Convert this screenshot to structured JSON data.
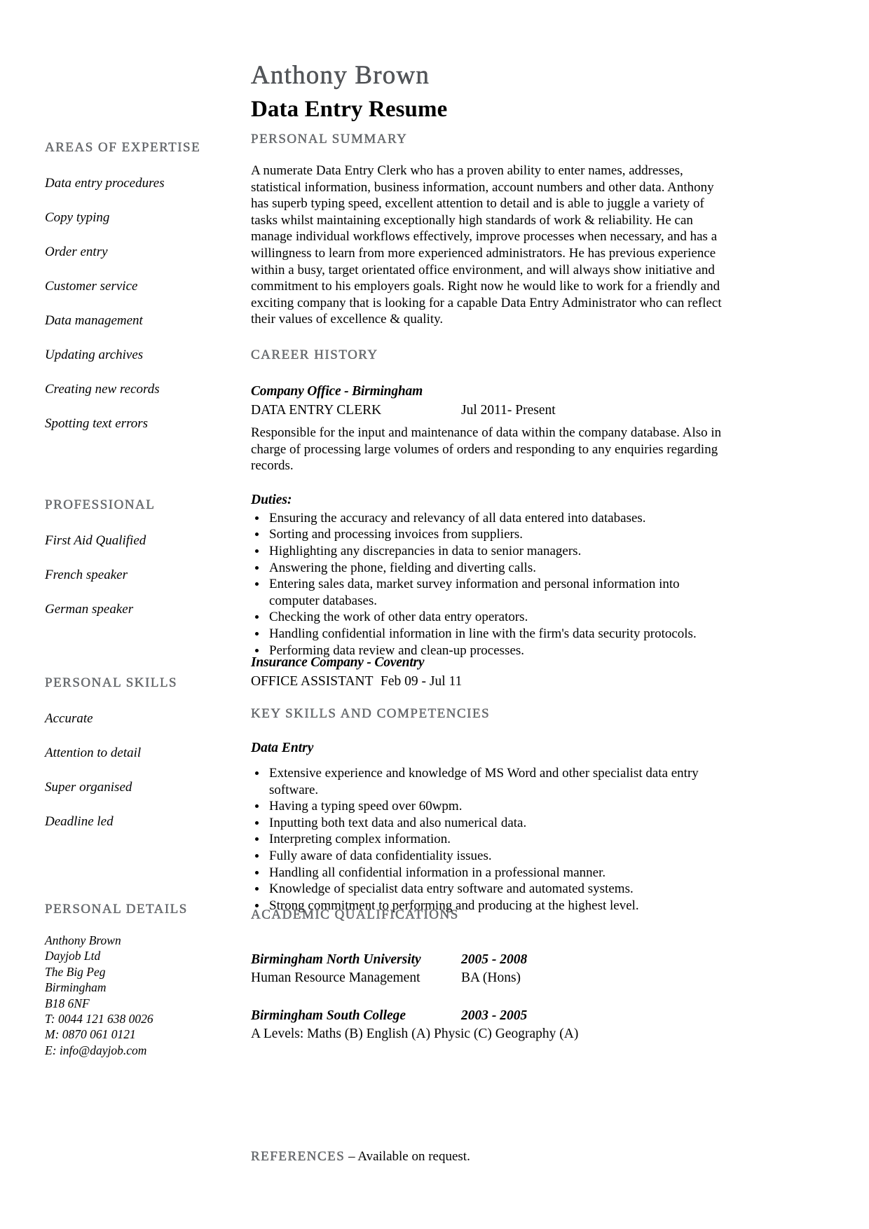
{
  "header": {
    "candidate_name": "Anthony Brown",
    "document_title": "Data Entry Resume"
  },
  "sidebar": {
    "expertise": {
      "heading": "AREAS OF EXPERTISE",
      "items": [
        "Data entry procedures",
        "Copy typing",
        "Order entry",
        "Customer service",
        "Data management",
        "Updating archives",
        "Creating new records",
        "Spotting text errors"
      ]
    },
    "professional": {
      "heading": "PROFESSIONAL",
      "items": [
        "First Aid Qualified",
        "French speaker",
        "German speaker"
      ]
    },
    "personal_skills": {
      "heading": "PERSONAL SKILLS",
      "items": [
        "Accurate",
        "Attention to detail",
        "Super organised",
        "Deadline led"
      ]
    },
    "personal_details": {
      "heading": "PERSONAL DETAILS",
      "lines": [
        "Anthony Brown",
        "Dayjob Ltd",
        "The Big Peg",
        "Birmingham",
        "B18 6NF",
        "T: 0044 121 638 0026",
        "M: 0870 061 0121",
        "E: info@dayjob.com"
      ]
    }
  },
  "main": {
    "personal_summary": {
      "heading": "PERSONAL SUMMARY",
      "text": "A numerate Data Entry Clerk who has a proven ability to enter names, addresses, statistical information, business information, account numbers and other data. Anthony has superb typing speed, excellent attention to detail and is able to juggle a variety of tasks whilst maintaining exceptionally high standards of work & reliability. He can manage individual workflows effectively, improve processes when necessary, and has a willingness to learn from more experienced administrators. He has previous experience within a busy, target orientated office environment, and will always show initiative and commitment to his employers goals. Right now he would like to work for a friendly and exciting company that is looking for a capable Data Entry Administrator who can reflect their values of excellence & quality."
    },
    "career_history": {
      "heading": "CAREER HISTORY",
      "jobs": [
        {
          "company": "Company Office - Birmingham",
          "role": "DATA ENTRY CLERK",
          "dates": "Jul 2011- Present",
          "description": "Responsible for the input and maintenance of data within the company database. Also in charge of processing large volumes of orders and responding to any enquiries regarding records.",
          "duties_label": "Duties:",
          "duties": [
            "Ensuring the accuracy and relevancy of all data entered into databases.",
            "Sorting and processing invoices from suppliers.",
            "Highlighting any discrepancies in data to senior managers.",
            "Answering the phone, fielding and diverting calls.",
            "Entering sales data, market survey information and personal information into computer databases.",
            "Checking the work of other data entry operators.",
            "Handling confidential information in line with the firm's data security protocols.",
            "Performing data review and clean-up processes."
          ]
        },
        {
          "company": "Insurance Company - Coventry",
          "role": "OFFICE ASSISTANT",
          "dates": "Feb 09 - Jul 11"
        }
      ]
    },
    "key_skills": {
      "heading": "KEY SKILLS AND COMPETENCIES",
      "sub_heading": "Data Entry",
      "items": [
        "Extensive experience and knowledge of MS Word and other specialist data entry software.",
        "Having a typing speed over 60wpm.",
        "Inputting both text data and also numerical data.",
        "Interpreting complex information.",
        "Fully aware of data confidentiality issues.",
        "Handling all confidential information in a professional manner.",
        "Knowledge of specialist data entry software and automated systems.",
        "Strong commitment to performing and producing at the highest level."
      ]
    },
    "academic": {
      "heading": "ACADEMIC QUALIFICATIONS",
      "entries": [
        {
          "institution": "Birmingham North University",
          "years": "2005 - 2008",
          "subject": "Human Resource Management",
          "award": "BA (Hons)"
        },
        {
          "institution": "Birmingham South College",
          "years": "2003 - 2005",
          "subject": "A Levels: Maths (B)  English (A) Physic  (C) Geography (A)",
          "award": ""
        }
      ]
    },
    "references": {
      "label": "REFERENCES",
      "text": " – Available on request."
    }
  }
}
